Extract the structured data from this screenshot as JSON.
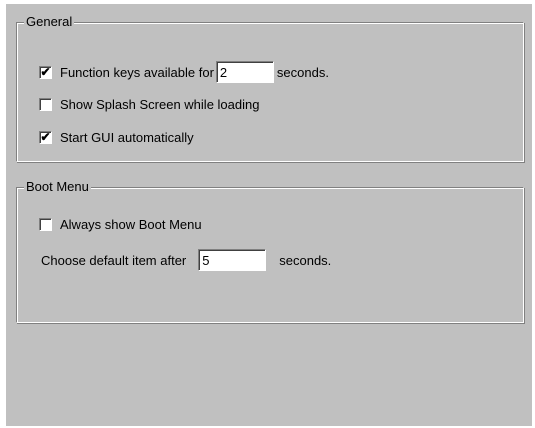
{
  "general": {
    "legend": "General",
    "function_keys": {
      "label": "Function keys available for",
      "checked": true,
      "value": "2",
      "suffix": "seconds."
    },
    "splash": {
      "label": "Show Splash Screen while loading",
      "checked": false
    },
    "start_gui": {
      "label": "Start GUI automatically",
      "checked": true
    }
  },
  "boot_menu": {
    "legend": "Boot Menu",
    "always_show": {
      "label": "Always show Boot Menu",
      "checked": false
    },
    "default_item": {
      "label": "Choose default item after",
      "value": "5",
      "suffix": "seconds."
    }
  },
  "check_glyph": "✔"
}
